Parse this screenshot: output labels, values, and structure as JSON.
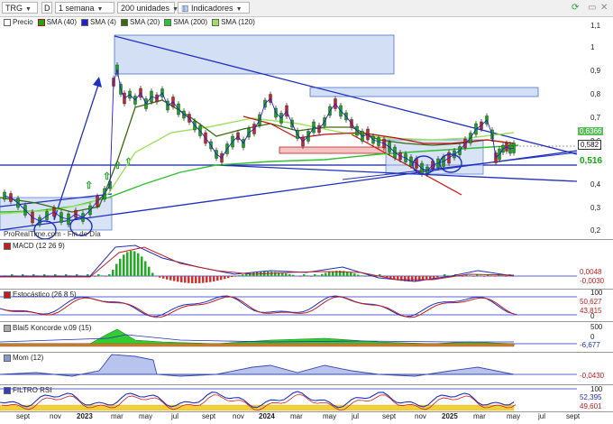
{
  "toolbar": {
    "ticker": "TRG",
    "period_code": "D",
    "interval": "1 semana",
    "units": "200 unidades",
    "indicators_label": "Indicadores"
  },
  "main_legend": {
    "price": "Precio",
    "sma40": "SMA (40)",
    "sma4": "SMA (4)",
    "sma20": "SMA (20)",
    "sma200": "SMA (200)",
    "sma120": "SMA (120)"
  },
  "colors": {
    "price_up": "#11aa11",
    "price_down": "#cc2222",
    "sma40": "#c01010",
    "sma4": "#2020d0",
    "sma20": "#3a6a10",
    "sma200": "#30c030",
    "sma120": "#a0e060",
    "trendline": "#2030c0"
  },
  "price_axis": {
    "ticks": [
      "1,1",
      "1",
      "0,9",
      "0,8",
      "0,7",
      "0,6",
      "0,5",
      "0,4",
      "0,3",
      "0,2"
    ],
    "labels": [
      "0,6366",
      "0,582",
      "0,516"
    ]
  },
  "watermark": "ProRealTime.com - Fin de Día",
  "panes": {
    "macd": {
      "title": "MACD (12 26 9)",
      "labels": [
        "0,0048",
        "-0,0030"
      ]
    },
    "stoch": {
      "title": "Estocástico (26 8 5)",
      "ticks": [
        "100",
        "0"
      ],
      "labels": [
        "50,627",
        "43,815"
      ]
    },
    "koncorde": {
      "title": "Blai5 Koncorde v.09 (15)",
      "ticks": [
        "500",
        "0"
      ],
      "labels": [
        "-6,677"
      ]
    },
    "mom": {
      "title": "Mom (12)",
      "labels": [
        "-0,0430"
      ]
    },
    "rsi": {
      "title": "FILTRO RSI",
      "ticks": [
        "100"
      ],
      "labels": [
        "52,395",
        "49,601"
      ]
    }
  },
  "months": [
    "sept",
    "nov",
    "2023",
    "mar",
    "may",
    "jul",
    "sept",
    "nov",
    "2024",
    "mar",
    "may",
    "jul",
    "sept",
    "nov",
    "2025",
    "mar",
    "may",
    "jul",
    "sept"
  ],
  "month_bold": [
    false,
    false,
    true,
    false,
    false,
    false,
    false,
    false,
    true,
    false,
    false,
    false,
    false,
    false,
    true,
    false,
    false,
    false,
    false
  ]
}
